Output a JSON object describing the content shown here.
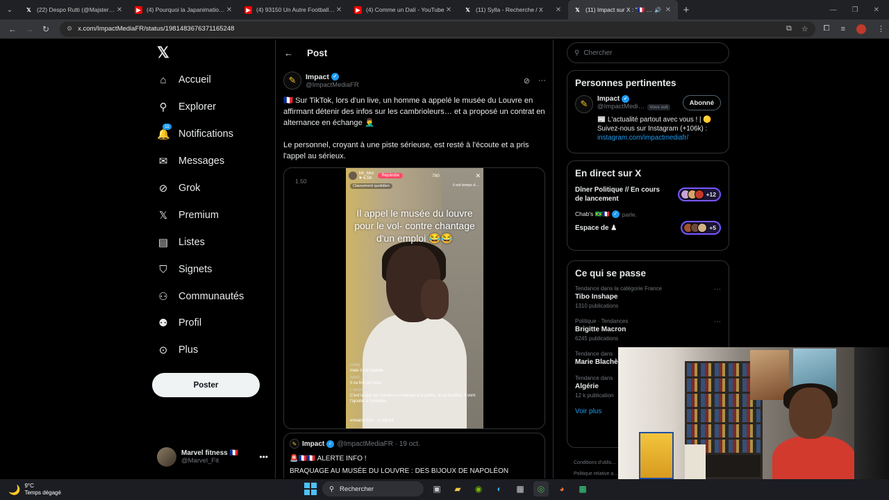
{
  "browser": {
    "tabs": [
      {
        "title": "(22) Despo Rutti (@MajsterOffi",
        "type": "x"
      },
      {
        "title": "(4) Pourquoi la Japanimation v",
        "type": "yt"
      },
      {
        "title": "(4) 93150 Un Autre Football Ep",
        "type": "yt"
      },
      {
        "title": "(4) Comme un Dalí - YouTube",
        "type": "yt"
      },
      {
        "title": "(11) Sylla - Recherche / X",
        "type": "x"
      },
      {
        "title": "(11) Impact sur X : \"🇫🇷 Sur T",
        "type": "x",
        "active": true
      }
    ],
    "url": "x.com/ImpactMediaFR/status/1981483676371165248"
  },
  "nav": {
    "logo": "𝕏",
    "items": [
      {
        "label": "Accueil",
        "icon": "⌂"
      },
      {
        "label": "Explorer",
        "icon": "⚲"
      },
      {
        "label": "Notifications",
        "icon": "🔔",
        "badge": "11"
      },
      {
        "label": "Messages",
        "icon": "✉"
      },
      {
        "label": "Grok",
        "icon": "⊘"
      },
      {
        "label": "Premium",
        "icon": "𝕏"
      },
      {
        "label": "Listes",
        "icon": "▤"
      },
      {
        "label": "Signets",
        "icon": "⛉"
      },
      {
        "label": "Communautés",
        "icon": "⚇"
      },
      {
        "label": "Profil",
        "icon": "⚉"
      },
      {
        "label": "Plus",
        "icon": "⊙"
      }
    ],
    "post_button": "Poster",
    "account": {
      "name": "Marvel fitness 🇫🇷",
      "handle": "@Marvel_Fit"
    }
  },
  "post": {
    "header": "Post",
    "author": {
      "name": "Impact",
      "handle": "@ImpactMediaFR"
    },
    "text1": "🇫🇷 Sur TikTok, lors d'un live, un homme a appelé le musée du Louvre en affirmant détenir des infos sur les cambrioleurs… et a proposé un contrat en alternance en échange 🤦‍♂️",
    "text2": "Le personnel, croyant à une piste sérieuse, est resté à l'écoute et a pris l'appel au sérieux.",
    "media": {
      "time": "1.50",
      "live_user": "bh_bko",
      "live_likes": "♥ 4.5K",
      "join_label": "Rejoindre",
      "viewers": "780",
      "classement": "Classement quotidien",
      "side_tag": "il est temps d…",
      "caption": "Il appel le musée du louvre pour le vol- contre chantage d'un emploi 😂😂",
      "comments": [
        {
          "user": "Gaby",
          "text": "mais il est malade"
        },
        {
          "user": "ABID_Mx",
          "text": "Il va finir au hebs"
        },
        {
          "user": "L'inconnu",
          "text": "C'est la que ton numéro est envoyé à la police, tu es localisé. Il vont t'ajouter à l'enquête"
        }
      ],
      "joined": "erwane.h2v · a rejoint"
    },
    "quote": {
      "name": "Impact",
      "handle": "@ImpactMediaFR · 19 oct.",
      "line1": "🚨🇫🇷🇫🇷 ALERTE INFO !",
      "line2": "BRAQUAGE AU MUSÉE DU LOUVRE : DES BIJOUX DE NAPOLÉON DÉROBÉS"
    }
  },
  "sidebar": {
    "search_placeholder": "Chercher",
    "relevant": {
      "title": "Personnes pertinentes",
      "name": "Impact",
      "handle": "@ImpactMedi…",
      "follows_you": "Vous suit",
      "follow_label": "Abonné",
      "bio": "📰 L'actualité partout avec vous ! | 🟡 Suivez-nous sur Instagram (+106k) :",
      "link": "instagram.com/impactmediafr/"
    },
    "live": {
      "title": "En direct sur X",
      "space1": {
        "title": "Dîner Politique // En cours de lancement",
        "count": "+12"
      },
      "host": "Chab's 🇧🇷🇫🇷",
      "host_action": "parle.",
      "space2": {
        "title": "Espace de ♟",
        "count": "+5"
      }
    },
    "trends": {
      "title": "Ce qui se passe",
      "items": [
        {
          "category": "Tendance dans la catégorie France",
          "name": "Tibo Inshape",
          "count": "1310 publications"
        },
        {
          "category": "Politique · Tendances",
          "name": "Brigitte Macron",
          "count": "6245 publications"
        },
        {
          "category": "Tendance dans",
          "name": "Marie Blachè",
          "count": ""
        },
        {
          "category": "Tendance dans",
          "name": "Algérie",
          "count": "12 k publication"
        }
      ],
      "more": "Voir plus"
    },
    "footer1": "Conditions d'utilis…",
    "footer2": "Politique relative a…"
  },
  "taskbar": {
    "temp": "9°C",
    "weather": "Temps dégagé",
    "search": "Rechercher"
  }
}
